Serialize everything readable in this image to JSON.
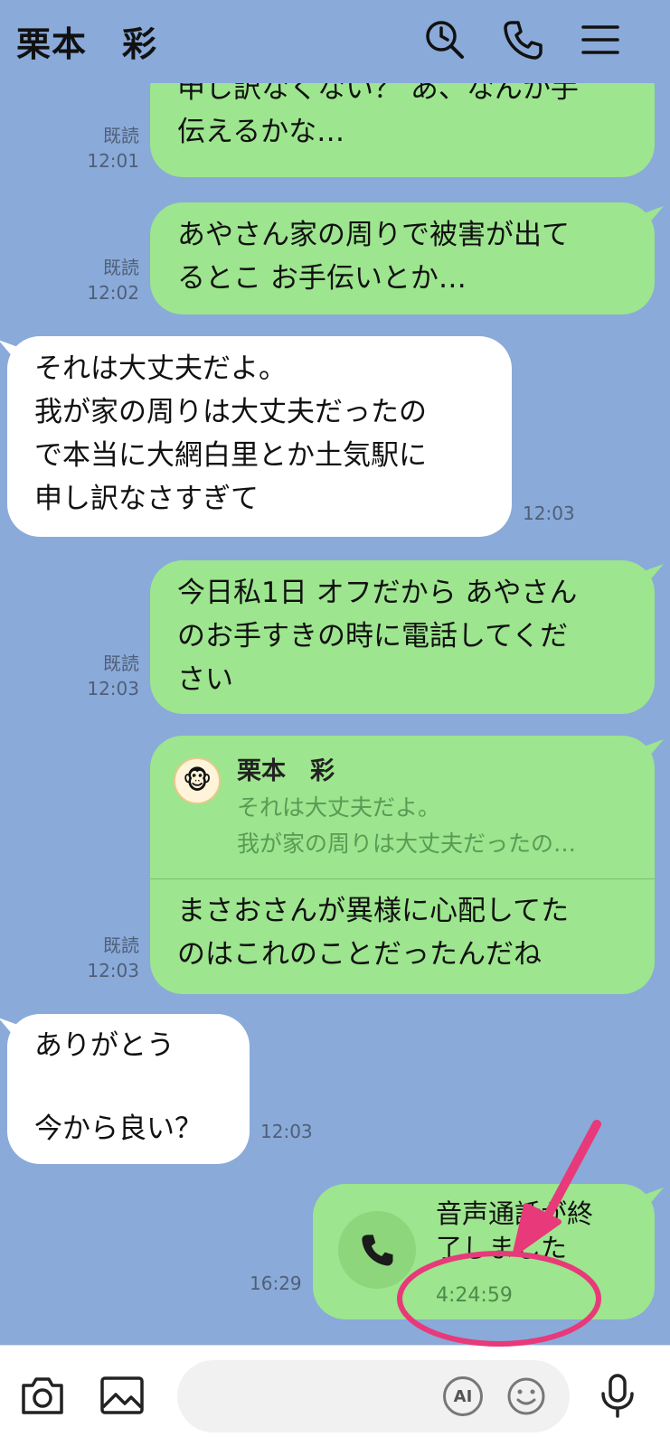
{
  "header": {
    "title": "栗本　彩",
    "icons": [
      "search-clock-icon",
      "phone-icon",
      "menu-icon"
    ]
  },
  "messages": [
    {
      "dir": "out",
      "text": "申し訳なくない？ あ、なんか手\n伝えるかな…",
      "read": "既読",
      "time": "12:01"
    },
    {
      "dir": "out",
      "text": "あやさん家の周りで被害が出て\nるとこ お手伝いとか…",
      "read": "既読",
      "time": "12:02"
    },
    {
      "dir": "in",
      "text": "それは大丈夫だよ。\n我が家の周りは大丈夫だったの\nで本当に大網白里とか土気駅に\n申し訳なさすぎて",
      "time": "12:03"
    },
    {
      "dir": "out",
      "text": "今日私1日 オフだから あやさん\nのお手すきの時に電話してくだ\nさい",
      "read": "既読",
      "time": "12:03"
    },
    {
      "dir": "out",
      "reply_name": "栗本　彩",
      "reply_quote1": "それは大丈夫だよ。",
      "reply_quote2": "我が家の周りは大丈夫だったの…",
      "text": "まさおさんが異様に心配してた\nのはこれのことだったんだね",
      "read": "既読",
      "time": "12:03"
    },
    {
      "dir": "in",
      "text": "ありがとう\n\n今から良い？",
      "time": "12:03"
    },
    {
      "dir": "out",
      "call_text": "音声通話が終\n了しました",
      "call_duration": "4:24:59",
      "time": "16:29"
    }
  ],
  "colors": {
    "background": "#8aaad9",
    "outgoing": "#9de58e",
    "incoming": "#ffffff",
    "annotation": "#e8397a"
  },
  "footer": {
    "icons": [
      "camera-icon",
      "image-icon",
      "ai-icon",
      "emoji-icon",
      "mic-icon"
    ],
    "ai_label": "AI"
  }
}
